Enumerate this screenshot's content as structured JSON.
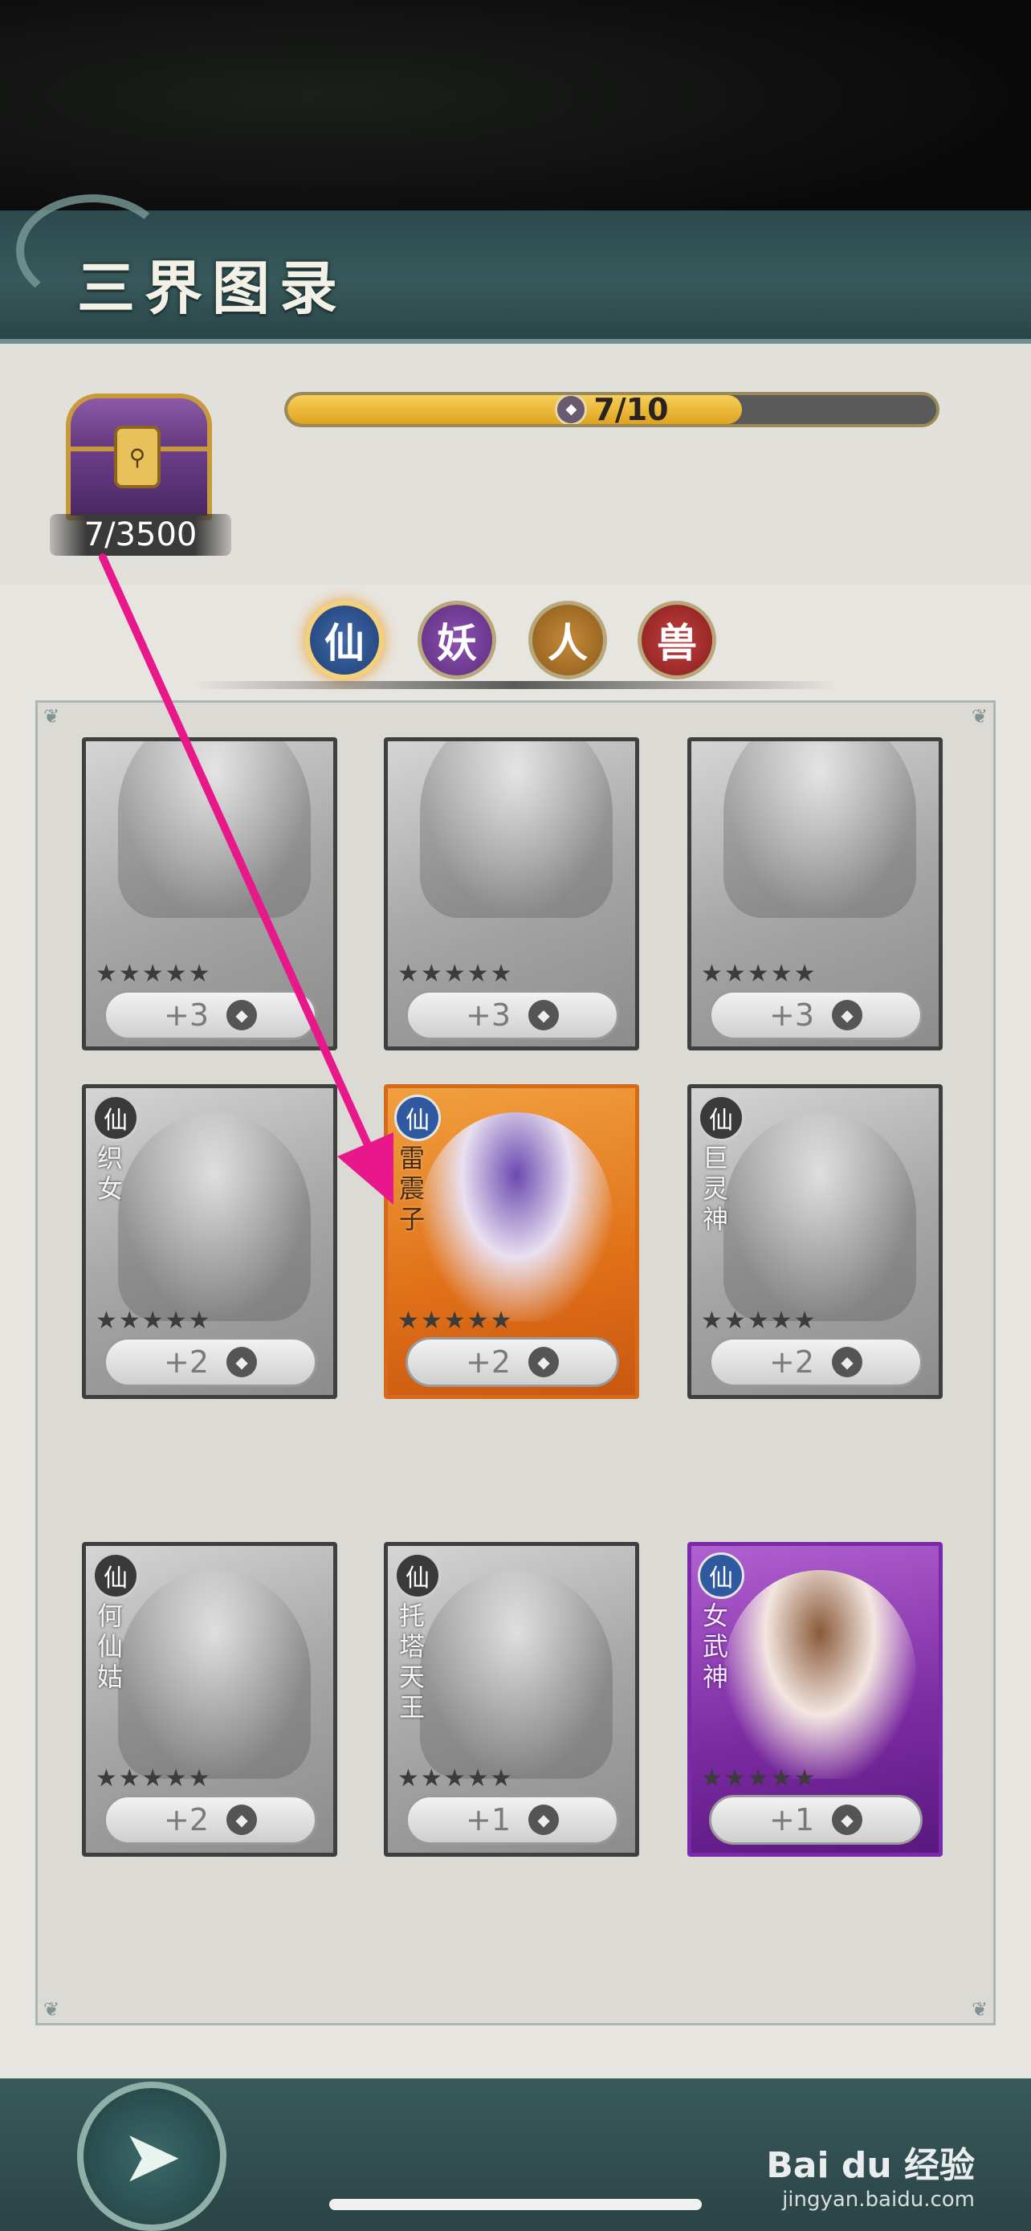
{
  "header": {
    "title": "三界图录"
  },
  "chest": {
    "count": "7/3500",
    "lock_glyph": "⚲"
  },
  "progress": {
    "label": "7/10",
    "value": 7,
    "max": 10
  },
  "tabs": [
    {
      "label": "仙",
      "selected": true
    },
    {
      "label": "妖",
      "selected": false
    },
    {
      "label": "人",
      "selected": false
    },
    {
      "label": "兽",
      "selected": false
    }
  ],
  "frame": {
    "corner_glyph": "❦"
  },
  "cards": [
    {
      "badge": "",
      "name": "",
      "stars": "★★★★★",
      "bonus": "+3",
      "style": "gray"
    },
    {
      "badge": "",
      "name": "",
      "stars": "★★★★★",
      "bonus": "+3",
      "style": "gray"
    },
    {
      "badge": "",
      "name": "",
      "stars": "★★★★★",
      "bonus": "+3",
      "style": "gray"
    },
    {
      "badge": "仙",
      "name": "织女",
      "stars": "★★★★★",
      "bonus": "+2",
      "style": "gray"
    },
    {
      "badge": "仙",
      "name": "雷震子",
      "stars": "★★★★★",
      "bonus": "+2",
      "style": "orange"
    },
    {
      "badge": "仙",
      "name": "巨灵神",
      "stars": "★★★★★",
      "bonus": "+2",
      "style": "gray"
    },
    {
      "badge": "仙",
      "name": "何仙姑",
      "stars": "★★★★★",
      "bonus": "+2",
      "style": "gray"
    },
    {
      "badge": "仙",
      "name": "托塔天王",
      "stars": "★★★★★",
      "bonus": "+1",
      "style": "gray"
    },
    {
      "badge": "仙",
      "name": "女武神",
      "stars": "★★★★★",
      "bonus": "+1",
      "style": "purple"
    }
  ],
  "footer": {
    "back_glyph": "➤"
  },
  "watermark": {
    "brand": "Bai du 经验",
    "site": "jingyan.baidu.com"
  },
  "colors": {
    "accent": "#e01a8c",
    "header": "#2c4a4d",
    "progress_fill": "#f0b83a"
  }
}
